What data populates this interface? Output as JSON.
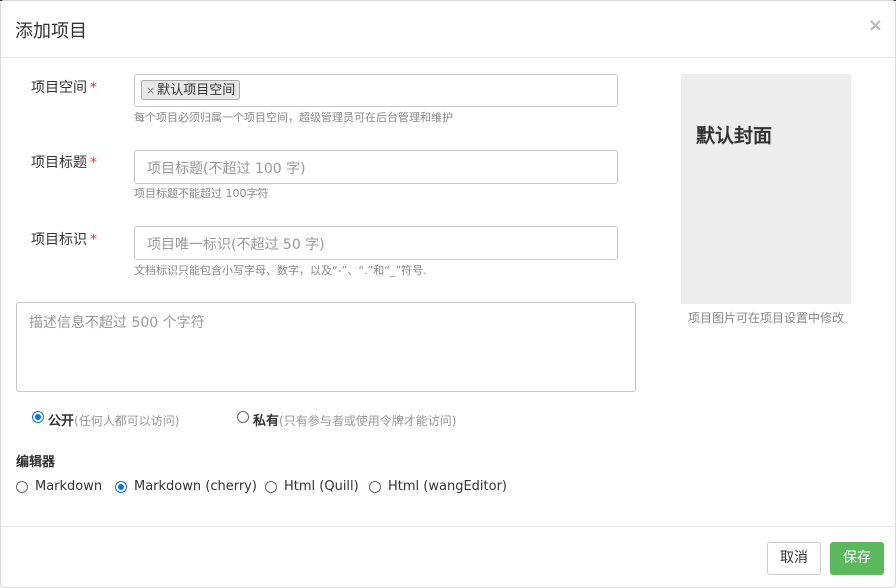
{
  "dialog": {
    "title": "添加项目",
    "close_glyph": "×"
  },
  "form": {
    "space": {
      "label": "项目空间",
      "required_mark": "*",
      "tag_value": "默认项目空间",
      "tag_remove_glyph": "×",
      "help": "每个项目必须归属一个项目空间，超级管理员可在后台管理和维护"
    },
    "title": {
      "label": "项目标题",
      "required_mark": "*",
      "placeholder": "项目标题(不超过 100 字)",
      "help": "项目标题不能超过 100字符"
    },
    "identifier": {
      "label": "项目标识",
      "required_mark": "*",
      "placeholder": "项目唯一标识(不超过 50 字)",
      "help": "文档标识只能包含小写字母、数字，以及“-”、“.”和“_”符号."
    },
    "description": {
      "placeholder": "描述信息不超过 500 个字符"
    },
    "visibility": {
      "options": [
        {
          "label": "公开",
          "note": "(任何人都可以访问)",
          "checked": true
        },
        {
          "label": "私有",
          "note": "(只有参与者或使用令牌才能访问)",
          "checked": false
        }
      ]
    },
    "editor": {
      "label": "编辑器",
      "options": [
        {
          "label": "Markdown",
          "checked": false
        },
        {
          "label": "Markdown (cherry)",
          "checked": true
        },
        {
          "label": "Html (Quill)",
          "checked": false
        },
        {
          "label": "Html (wangEditor)",
          "checked": false
        }
      ]
    }
  },
  "cover": {
    "title": "默认封面",
    "help": "项目图片可在项目设置中修改"
  },
  "footer": {
    "cancel_label": "取消",
    "save_label": "保存"
  },
  "colors": {
    "accent": "#0a74da",
    "save_button": "#5cb85c",
    "required": "#e4393c"
  }
}
